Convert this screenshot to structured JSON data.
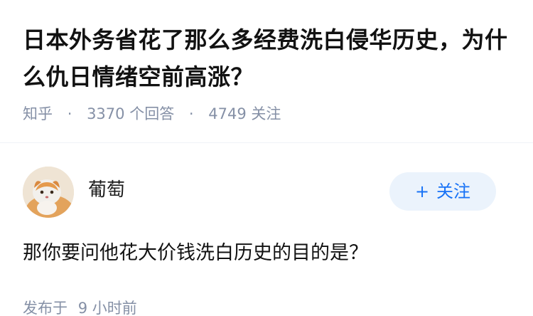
{
  "question": {
    "title": "日本外务省花了那么多经费洗白侵华历史，为什么仇日情绪空前高涨？",
    "source": "知乎",
    "answer_count": "3370",
    "answer_suffix": "个回答",
    "follower_count": "4749",
    "follower_suffix": "关注",
    "separator": "·"
  },
  "answer": {
    "author_name": "葡萄",
    "avatar_icon": "cat-avatar-icon",
    "follow_label": "关注",
    "follow_icon": "+",
    "content": "那你要问他花大价钱洗白历史的目的是？",
    "publish_prefix": "发布于",
    "publish_value": "9 小时前"
  },
  "colors": {
    "accent": "#1772f6",
    "accent_bg": "#ebf3fc",
    "muted": "#8590a6",
    "title": "#121212"
  }
}
